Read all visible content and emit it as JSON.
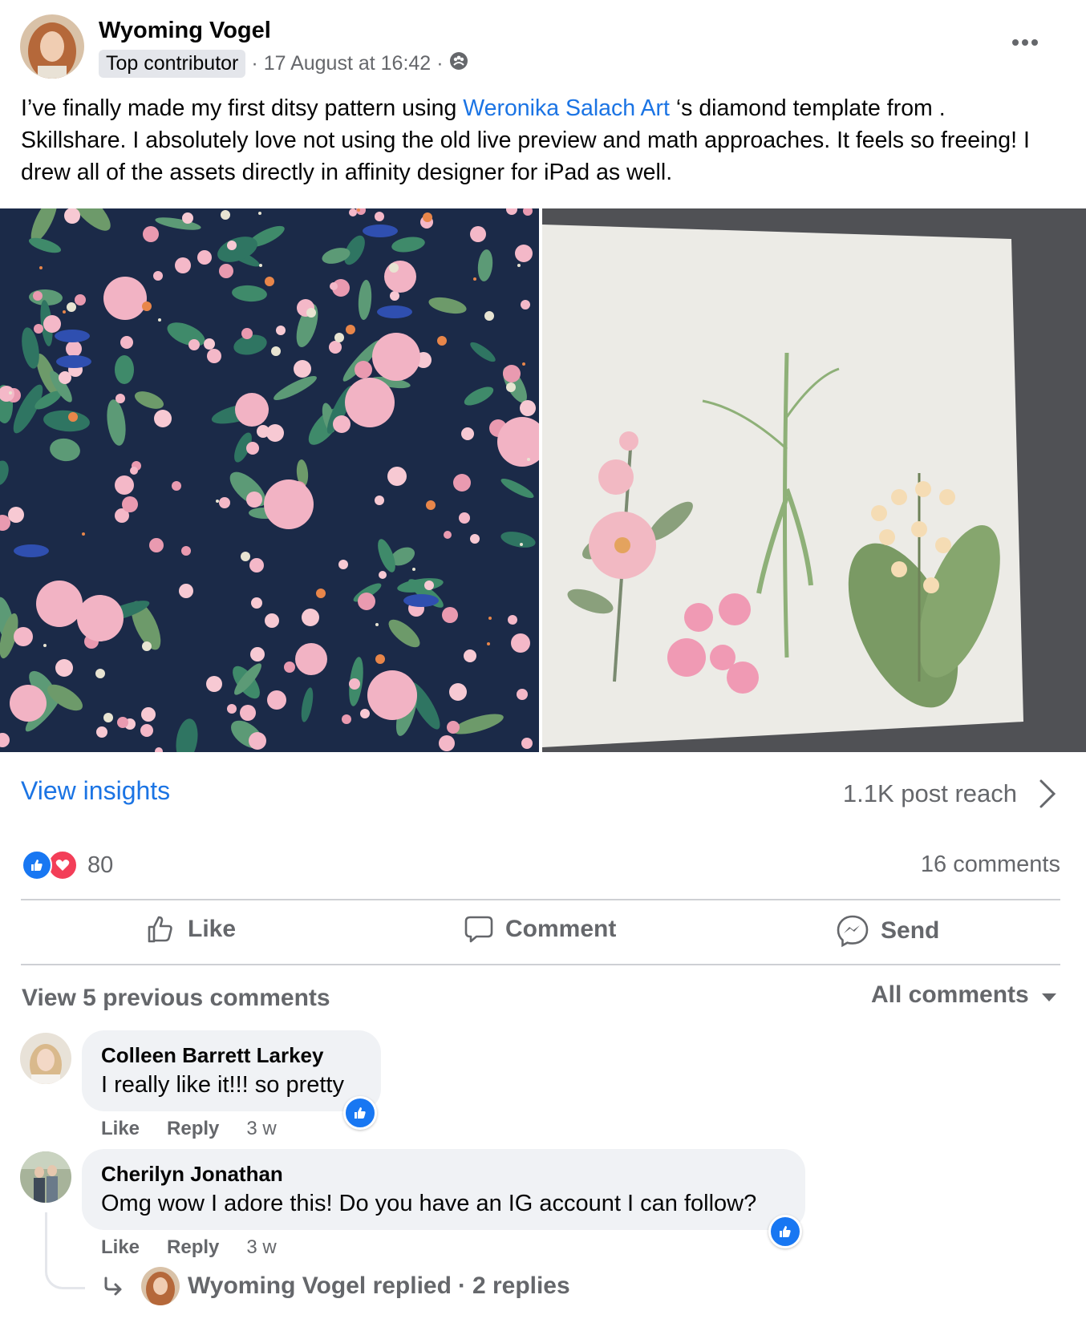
{
  "post": {
    "author": "Wyoming Vogel",
    "badge": "Top contributor",
    "sep1": "·",
    "timestamp": "17 August at 16:42",
    "sep2": "·",
    "privacy_icon": "group-audience-icon",
    "text_before_link": "I’ve finally made my first ditsy pattern using ",
    "mention": "Weronika Salach Art",
    "text_after_link": " ‘s diamond template from . Skillshare. I absolutely love not using the old live preview and math approaches. It feels so freeing! I drew all of the assets directly in affinity designer for iPad as well."
  },
  "insights": {
    "view_label": "View insights",
    "reach_label": "1.1K post reach"
  },
  "reactions": {
    "icons": [
      "like-reaction-icon",
      "love-reaction-icon"
    ],
    "count": "80",
    "comments_label": "16 comments"
  },
  "actions": {
    "like": "Like",
    "comment": "Comment",
    "send": "Send"
  },
  "comments_section": {
    "view_previous": "View 5 previous comments",
    "filter": "All comments"
  },
  "comments": [
    {
      "name": "Colleen Barrett Larkey",
      "text": "I really like it!!! so pretty",
      "like": "Like",
      "reply": "Reply",
      "time": "3 w"
    },
    {
      "name": "Cherilyn Jonathan",
      "text": "Omg wow I adore this! Do you have an IG account I can follow?",
      "like": "Like",
      "reply": "Reply",
      "time": "3 w"
    }
  ],
  "reply_summary": {
    "replied": "Wyoming Vogel replied",
    "sep": "·",
    "count": "2 replies"
  },
  "colors": {
    "link": "#1b74e4",
    "like_blue": "#1877f2",
    "love_red": "#f33e58",
    "muted": "#65676b",
    "bubble": "#f0f2f5",
    "pattern_bg": "#1b2a48"
  }
}
